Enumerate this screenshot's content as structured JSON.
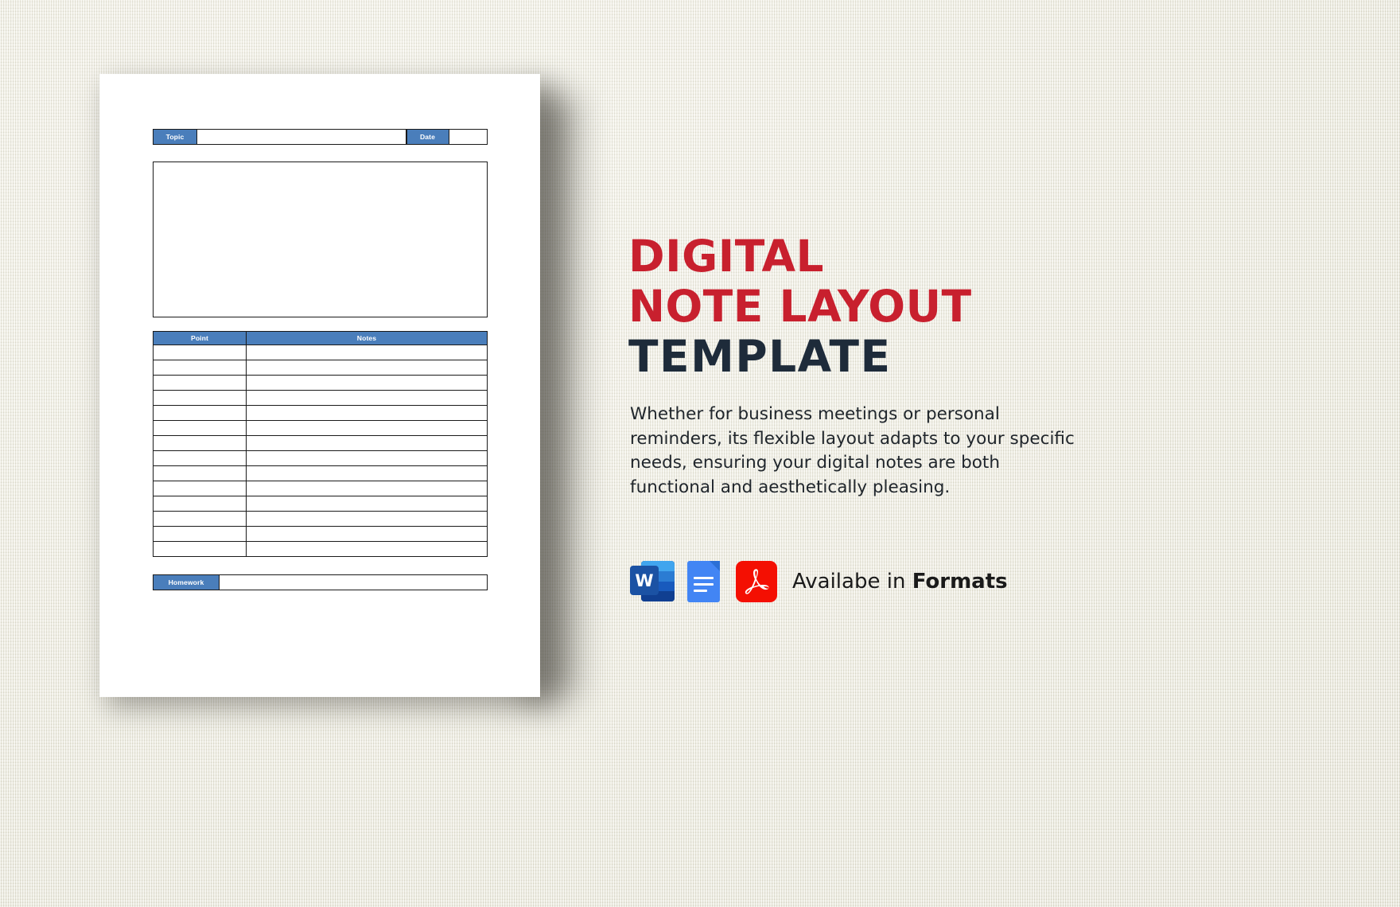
{
  "background": {
    "color": "#eceadc",
    "texture": "linen"
  },
  "document": {
    "name": "digital-note-layout-template-page",
    "topic_row": {
      "topic_label": "Topic",
      "topic_value": "",
      "date_label": "Date",
      "date_value": ""
    },
    "freeform_box": {
      "value": ""
    },
    "notes_table": {
      "columns": [
        "Point",
        "Notes"
      ],
      "rows": [
        [
          "",
          ""
        ],
        [
          "",
          ""
        ],
        [
          "",
          ""
        ],
        [
          "",
          ""
        ],
        [
          "",
          ""
        ],
        [
          "",
          ""
        ],
        [
          "",
          ""
        ],
        [
          "",
          ""
        ],
        [
          "",
          ""
        ],
        [
          "",
          ""
        ],
        [
          "",
          ""
        ],
        [
          "",
          ""
        ],
        [
          "",
          ""
        ],
        [
          "",
          ""
        ]
      ]
    },
    "homework_row": {
      "label": "Homework",
      "value": ""
    },
    "accent_color": "#4a7ebb",
    "border_color": "#1a1a1a"
  },
  "promo": {
    "title_line_1": "DIGITAL",
    "title_line_2": "NOTE LAYOUT",
    "title_line_3": "TEMPLATE",
    "title_red": "#c8202e",
    "title_dark": "#1e2b3a",
    "description": "Whether for business meetings or personal reminders, its flexible layout adapts to your specific needs, ensuring your digital notes are both functional and aesthetically pleasing.",
    "formats": {
      "availability_prefix": "Availabe in ",
      "availability_strong": "Formats",
      "icons": [
        {
          "name": "microsoft-word-icon",
          "glyph": "W",
          "color": "#185abd"
        },
        {
          "name": "google-docs-icon",
          "glyph": "",
          "color": "#4285f4"
        },
        {
          "name": "adobe-pdf-icon",
          "glyph": "",
          "color": "#f40f02"
        }
      ]
    }
  }
}
